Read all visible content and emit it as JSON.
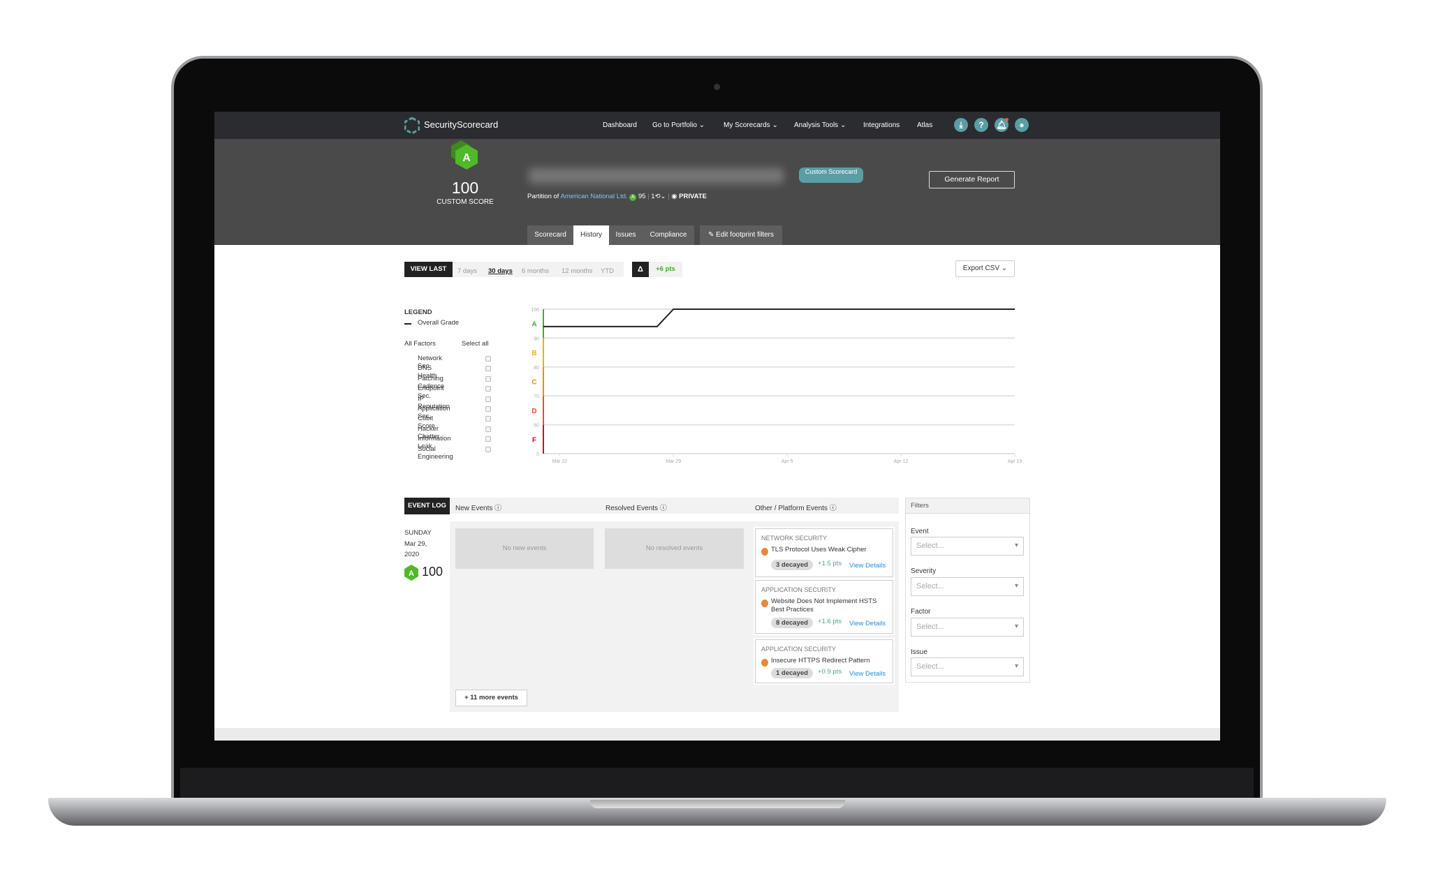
{
  "nav": {
    "brand": "SecurityScorecard",
    "items": [
      "Dashboard",
      "Go to Portfolio",
      "My Scorecards",
      "Analysis Tools",
      "Integrations",
      "Atlas"
    ],
    "has_dropdown": [
      false,
      true,
      true,
      true,
      false,
      false
    ],
    "icons": [
      "download-icon",
      "help-icon",
      "bell-icon",
      "user-icon"
    ]
  },
  "header": {
    "grade": "A",
    "score": "100",
    "score_label": "CUSTOM SCORE",
    "badge": "Custom Scorecard",
    "partition_prefix": "Partition of",
    "parent": "American National Ltd.",
    "parent_grade": "A",
    "parent_score": "95",
    "followers": "1",
    "privacy": "PRIVATE",
    "generate_report": "Generate Report"
  },
  "tabs": [
    {
      "label": "Scorecard",
      "active": false
    },
    {
      "label": "History",
      "active": true
    },
    {
      "label": "Issues",
      "active": false
    },
    {
      "label": "Compliance",
      "active": false
    }
  ],
  "edit_filters": "Edit footprint filters",
  "range": {
    "label": "VIEW LAST",
    "options": [
      "7 days",
      "30 days",
      "6 months",
      "12 months",
      "YTD"
    ],
    "selected": "30 days",
    "delta_symbol": "Δ",
    "delta": "+6 pts",
    "export": "Export CSV"
  },
  "legend": {
    "title": "LEGEND",
    "series": "Overall Grade",
    "all_factors": "All Factors",
    "select_all": "Select all",
    "factors": [
      "Network Sec.",
      "DNS Health",
      "Patching Cadence",
      "Endpoint Sec.",
      "IP Reputation",
      "Application Sec.",
      "Cubit Score",
      "Hacker Chatter",
      "Information Leak",
      "Social Engineering"
    ]
  },
  "chart_data": {
    "type": "line",
    "series": [
      {
        "name": "Overall Grade",
        "x": [
          "Mar 21",
          "Mar 28",
          "Mar 29",
          "Apr 19"
        ],
        "y": [
          94,
          94,
          100,
          100
        ]
      }
    ],
    "x_ticks": [
      "Mar 22",
      "Mar 29",
      "Apr 5",
      "Apr 12",
      "Apr 19"
    ],
    "y_ticks": [
      "100",
      "90",
      "80",
      "70",
      "60",
      "0"
    ],
    "grade_bands": [
      {
        "grade": "A",
        "color": "#3fae29"
      },
      {
        "grade": "B",
        "color": "#e8b400"
      },
      {
        "grade": "C",
        "color": "#f08c00"
      },
      {
        "grade": "D",
        "color": "#ef4b1f"
      },
      {
        "grade": "F",
        "color": "#c8101e"
      }
    ],
    "ylim": [
      0,
      100
    ],
    "grid": true
  },
  "event_log": {
    "title": "EVENT LOG",
    "cols": [
      "New Events",
      "Resolved Events",
      "Other / Platform Events"
    ],
    "day": "SUNDAY",
    "date": "Mar 29,",
    "year": "2020",
    "grade": "A",
    "score": "100",
    "no_new": "No new events",
    "no_resolved": "No resolved events",
    "more": "+ 11 more events",
    "events": [
      {
        "category": "NETWORK SECURITY",
        "title": "TLS Protocol Uses Weak Cipher",
        "decayed": "3 decayed",
        "pts": "+1.5 pts",
        "link": "View Details"
      },
      {
        "category": "APPLICATION SECURITY",
        "title": "Website Does Not Implement HSTS Best Practices",
        "decayed": "8 decayed",
        "pts": "+1.6 pts",
        "link": "View Details"
      },
      {
        "category": "APPLICATION SECURITY",
        "title": "Insecure HTTPS Redirect Pattern",
        "decayed": "1 decayed",
        "pts": "+0.9 pts",
        "link": "View Details"
      }
    ]
  },
  "filters": {
    "title": "Filters",
    "fields": [
      {
        "label": "Event",
        "placeholder": "Select..."
      },
      {
        "label": "Severity",
        "placeholder": "Select..."
      },
      {
        "label": "Factor",
        "placeholder": "Select..."
      },
      {
        "label": "Issue",
        "placeholder": "Select..."
      }
    ]
  }
}
